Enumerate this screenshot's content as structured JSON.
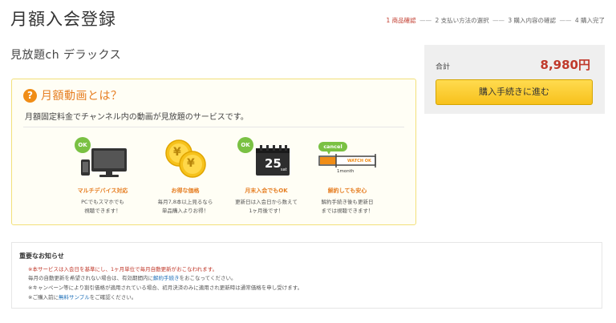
{
  "page_title": "月額入会登録",
  "steps": [
    {
      "label": "1 商品確認",
      "active": true
    },
    {
      "label": "2 支払い方法の選択",
      "active": false
    },
    {
      "label": "3 購入内容の確認",
      "active": false
    },
    {
      "label": "4 購入完了",
      "active": false
    }
  ],
  "step_separator": "——",
  "product_name": "見放題ch デラックス",
  "info": {
    "icon_char": "?",
    "title": "月額動画とは？",
    "description": "月額固定料金でチャンネル内の動画が見放題のサービスです。"
  },
  "features": [
    {
      "icon": "multi-device-icon",
      "badge": "OK",
      "title": "マルチデバイス対応",
      "lines": [
        "PCでもスマホでも",
        "視聴できます！"
      ]
    },
    {
      "icon": "coins-icon",
      "coin_char": "¥",
      "title": "お得な価格",
      "lines": [
        "毎月7,8本以上見るなら",
        "単品購入よりお得！"
      ]
    },
    {
      "icon": "calendar-icon",
      "badge": "OK",
      "calendar_day": "25",
      "calendar_sub": "sat",
      "title": "月末入会でもOK",
      "lines": [
        "更新日は入会日から数えて",
        "1ヶ月後です！"
      ]
    },
    {
      "icon": "cancel-icon",
      "cancel_label": "cancel",
      "watch_label": "WATCH OK",
      "period_label": "1month",
      "title": "解約しても安心",
      "lines": [
        "解約手続き後も更新日",
        "までは視聴できます！"
      ]
    }
  ],
  "summary": {
    "total_label": "合計",
    "total_price": "8,980円",
    "button_label": "購入手続きに進む"
  },
  "notice": {
    "title": "重要なお知らせ",
    "line1_prefix": "※",
    "line1_red": "本サービスは入会日を基準にし、1ヶ月単位で毎月自動更新がおこなわれます。",
    "line2_text": "毎月の自動更新を希望されない場合は、有効期間内に",
    "line2_link": "解約手続き",
    "line2_after": "をおこなってください。",
    "line3": "※キャンペーン等により割引価格が適用されている場合、初月決済のみに適用され更新時は通常価格を申し受けます。",
    "line4_prefix": "※ご購入前に",
    "line4_link": "無料サンプル",
    "line4_after": "をご確認ください。"
  },
  "colors": {
    "accent_orange": "#e67e22",
    "price_red": "#c0392b",
    "button_yellow": "#f7c11c",
    "ok_green": "#7ac143"
  }
}
